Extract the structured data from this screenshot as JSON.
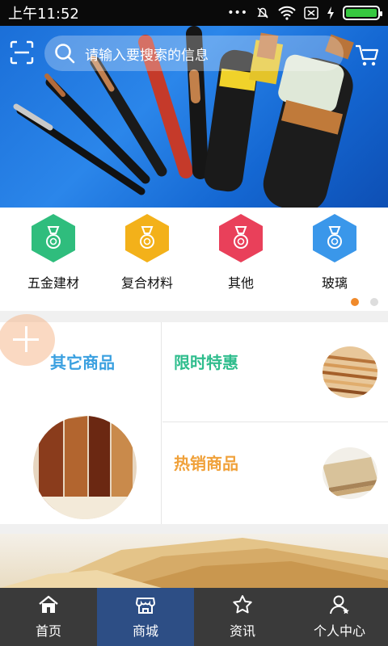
{
  "status_bar": {
    "time": "上午11:52",
    "dots": "•••"
  },
  "search": {
    "placeholder": "请输入要搜索的信息"
  },
  "categories": [
    {
      "label": "五金建材",
      "color": "#2fbd7d",
      "icon": "medal-icon"
    },
    {
      "label": "复合材料",
      "color": "#f3b11a",
      "icon": "medal-icon"
    },
    {
      "label": "其他",
      "color": "#e9405a",
      "icon": "medal-icon"
    },
    {
      "label": "玻璃",
      "color": "#3a97ea",
      "icon": "medal-icon"
    }
  ],
  "carousel": {
    "pages": 2,
    "active": 1,
    "active_color": "#f08a2b"
  },
  "promos": {
    "other": {
      "title": "其它商品",
      "color": "#3aa0e0"
    },
    "limited": {
      "title": "限时特惠",
      "color": "#2fbd8d"
    },
    "hot": {
      "title": "热销商品",
      "color": "#f0a13a"
    }
  },
  "tabbar": {
    "items": [
      {
        "label": "首页",
        "icon": "home-icon"
      },
      {
        "label": "商城",
        "icon": "shop-icon",
        "active": true
      },
      {
        "label": "资讯",
        "icon": "star-icon"
      },
      {
        "label": "个人中心",
        "icon": "user-icon"
      }
    ]
  }
}
